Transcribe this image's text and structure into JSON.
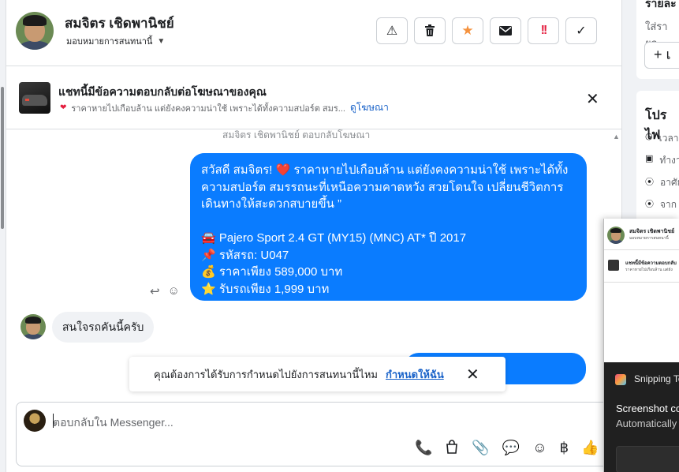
{
  "header": {
    "contact_name": "สมจิตร เชิดพานิชย์",
    "assign_label": "มอบหมายการสนทนานี้",
    "buttons": {
      "spam_icon": "⚠",
      "delete_icon": "🗑",
      "star_icon": "★",
      "mail_icon": "✉",
      "urgent_icon": "!!",
      "done_icon": "✓"
    }
  },
  "ad_banner": {
    "title": "แชทนี้มีข้อความตอบกลับต่อโฆษณาของคุณ",
    "subtitle": "ราคาหายไปเกือบล้าน แต่ยังคงความน่าใช้ เพราะได้ทั้งความสปอร์ต สมร...",
    "link": "ดูโฆษณา"
  },
  "chat": {
    "reply_note": "สมจิตร เชิดพานิชย์ ตอบกลับโฆษณา",
    "outgoing_message_lines": [
      "สวัสดี สมจิตร! ❤️ ราคาหายไปเกือบล้าน แต่ยังคงความน่าใช้ เพราะได้ทั้ง",
      "ความสปอร์ต สมรรถนะที่เหนือความคาดหวัง สวยโดนใจ เปลี่ยนชีวิตการ",
      "เดินทางให้สะดวกสบายขึ้น ”",
      "",
      "🚘 Pajero Sport 2.4 GT (MY15) (MNC) AT* ปี 2017",
      "📌 รหัสรถ: U047",
      "💰 ราคาเพียง 589,000 บาท",
      "⭐ รับรถเพียง 1,999 บาท"
    ],
    "incoming_message": "สนใจรถคันนี้ครับ"
  },
  "toast": {
    "text": "คุณต้องการได้รับการกำหนดไปยังการสนทนานี้ไหม",
    "action": "กำหนดให้ฉัน"
  },
  "composer": {
    "placeholder": "ตอบกลับใน Messenger..."
  },
  "right_panel": {
    "title1": "รายละ",
    "subtitle1": "ใส่รายล",
    "add_label": "+ เ",
    "title2": "โปรไฟ",
    "rows": [
      "เวลา",
      "ทำงา",
      "อาศัย",
      "จาก"
    ]
  },
  "snipping": {
    "mini_name": "สมจิตร เชิดพานิชย์",
    "mini_sub": "มอบหมายการสนทนานี้",
    "mini_title": "แชทนี้มีข้อความตอบกลับ",
    "mini_desc": "ราคาหายไปเกือบล้าน แต่ยัง",
    "app_name": "Snipping To",
    "notif_title": "Screenshot co",
    "notif_body": "Automatically"
  }
}
